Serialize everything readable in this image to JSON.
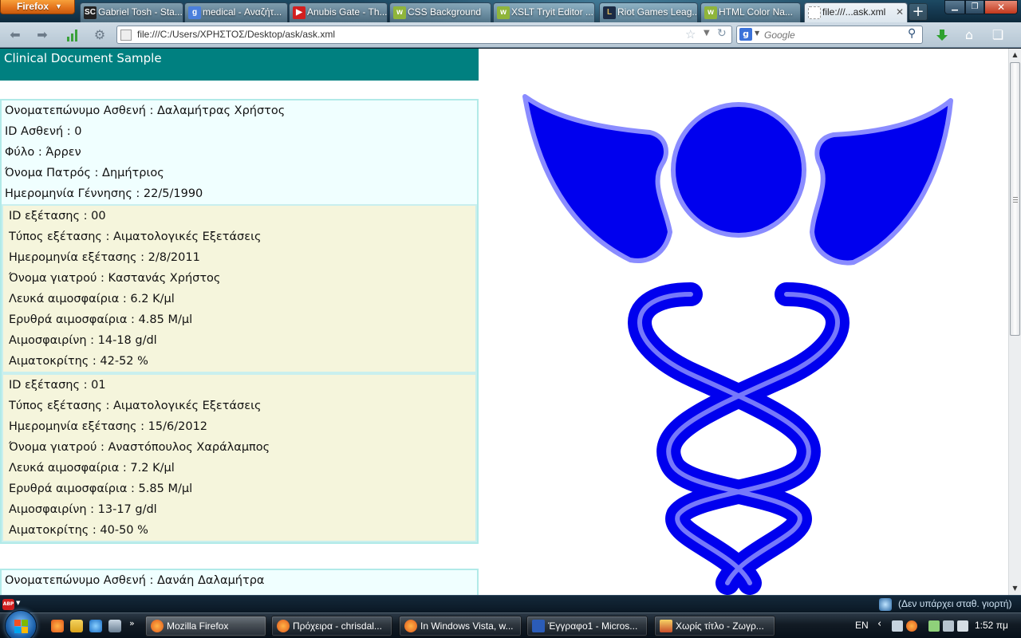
{
  "browser": {
    "menu_label": "Firefox",
    "tabs": [
      {
        "label": "Gabriel Tosh - Sta...",
        "icon": "sc-icon"
      },
      {
        "label": "medical - Αναζήτ...",
        "icon": "google-icon"
      },
      {
        "label": "Anubis Gate - Th...",
        "icon": "youtube-icon"
      },
      {
        "label": "CSS Background",
        "icon": "w3schools-icon"
      },
      {
        "label": "XSLT Tryit Editor ...",
        "icon": "w3schools-icon"
      },
      {
        "label": "Riot Games Leag...",
        "icon": "league-icon"
      },
      {
        "label": "HTML Color Na...",
        "icon": "w3schools-icon"
      },
      {
        "label": "file:///...ask.xml",
        "icon": "blank-page-icon"
      }
    ],
    "url": "file:///C:/Users/ΧΡΗΣΤΟΣ/Desktop/ask/ask.xml",
    "search_placeholder": "Google",
    "colors": {
      "firefox_button": "#e2711b",
      "chrome_blue": "#163a52"
    }
  },
  "document": {
    "header_title": "Clinical Document Sample",
    "colors": {
      "header": "#008080",
      "patient_bg": "#f0ffff",
      "exam_bg": "#f5f5dc",
      "logo": "#0000ee"
    },
    "patients": [
      {
        "name_line": "Ονοματεπώνυμο Ασθενή : Δαλαμήτρας Χρήστος",
        "id_line": "ID Ασθενή : 0",
        "sex_line": "Φύλο : Άρρεν",
        "father_line": "Όνομα Πατρός : Δημήτριος",
        "birth_line": "Ημερομηνία Γέννησης : 22/5/1990",
        "exams": [
          {
            "id_line": "ID εξέτασης : 00",
            "type_line": "Τύπος εξέτασης : Αιματολογικές Εξετάσεις",
            "date_line": "Ημερομηνία εξέτασης : 2/8/2011",
            "doctor_line": "Όνομα γιατρού : Καστανάς Χρήστος",
            "wbc_line": "Λευκά αιμοσφαίρια : 6.2 Κ/μl",
            "rbc_line": "Ερυθρά αιμοσφαίρια : 4.85 Μ/μl",
            "hgb_line": "Αιμοσφαιρίνη : 14-18 g/dl",
            "hct_line": "Αιματοκρίτης : 42-52 %"
          },
          {
            "id_line": "ID εξέτασης : 01",
            "type_line": "Τύπος εξέτασης : Αιματολογικές Εξετάσεις",
            "date_line": "Ημερομηνία εξέτασης : 15/6/2012",
            "doctor_line": "Όνομα γιατρού : Αναστόπουλος Χαράλαμπος",
            "wbc_line": "Λευκά αιμοσφαίρια : 7.2 Κ/μl",
            "rbc_line": "Ερυθρά αιμοσφαίρια : 5.85 Μ/μl",
            "hgb_line": "Αιμοσφαιρίνη : 13-17 g/dl",
            "hct_line": "Αιματοκρίτης : 40-50 %"
          }
        ]
      },
      {
        "name_line": "Ονοματεπώνυμο Ασθενή : Δανάη Δαλαμήτρα"
      }
    ]
  },
  "statusbar": {
    "text": "(Δεν υπάρχει σταθ. γιορτή)"
  },
  "taskbar": {
    "tasks": [
      {
        "label": "Mozilla Firefox",
        "icon": "firefox-icon"
      },
      {
        "label": "Πρόχειρα - chrisdal...",
        "icon": "firefox-icon"
      },
      {
        "label": "In Windows Vista, w...",
        "icon": "firefox-icon"
      },
      {
        "label": "Έγγραφο1 - Micros...",
        "icon": "word-icon"
      },
      {
        "label": "Χωρίς τίτλο - Ζωγρ...",
        "icon": "paint-icon"
      }
    ],
    "language": "EN",
    "clock": "1:52 πμ"
  }
}
